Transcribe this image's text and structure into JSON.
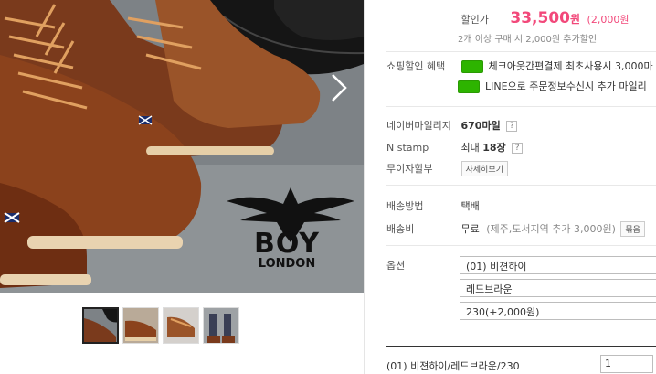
{
  "hero": {
    "brand_name": "BOY",
    "brand_sub": "LONDON"
  },
  "thumbnails": [
    {
      "name": "thumb-1",
      "active": true
    },
    {
      "name": "thumb-2",
      "active": false
    },
    {
      "name": "thumb-3",
      "active": false
    },
    {
      "name": "thumb-4",
      "active": false
    }
  ],
  "price": {
    "discount_label": "할인가",
    "discount_price": "33,500",
    "currency": "원",
    "discount_amount": "(2,000원",
    "bulk_note": "2개 이상 구매 시 2,000원 추가할인"
  },
  "shopping_benefit": {
    "label": "쇼핑할인 혜택",
    "line1": "체크아웃간편결제 최초사용시 3,000마",
    "line2": "LINE으로 주문정보수신시 추가 마일리"
  },
  "mileage": {
    "label": "네이버마일리지",
    "value": "670마일",
    "help": "?"
  },
  "nstamp": {
    "label": "N stamp",
    "value_prefix": "최대",
    "value": "18장",
    "help": "?"
  },
  "installment": {
    "label": "무이자할부",
    "button": "자세히보기"
  },
  "shipping_method": {
    "label": "배송방법",
    "value": "택배"
  },
  "shipping_fee": {
    "label": "배송비",
    "value": "무료",
    "note": "(제주,도서지역 추가 3,000원)",
    "button": "묶음"
  },
  "options": {
    "label": "옵션",
    "select1": "(01) 비젼하이",
    "select2": "레드브라운",
    "select3": "230(+2,000원)"
  },
  "selected": {
    "text": "(01) 비젼하이/레드브라운/230",
    "quantity": "1"
  },
  "colors": {
    "accent": "#f2487a",
    "naver_green": "#2db400"
  }
}
